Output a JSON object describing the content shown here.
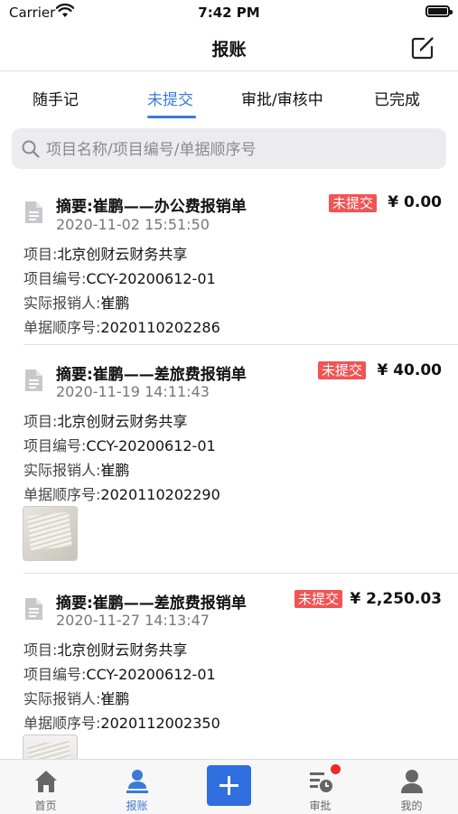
{
  "status": {
    "carrier": "Carrier",
    "time": "7:42 PM"
  },
  "nav": {
    "title": "报账",
    "edit_icon": "edit-icon"
  },
  "tabs": [
    {
      "label": "随手记",
      "active": false
    },
    {
      "label": "未提交",
      "active": true
    },
    {
      "label": "审批/审核中",
      "active": false
    },
    {
      "label": "已完成",
      "active": false
    }
  ],
  "search": {
    "placeholder": "项目名称/项目编号/单据顺序号",
    "value": ""
  },
  "labels": {
    "project": "项目:",
    "project_no": "项目编号:",
    "reimburser": "实际报销人:",
    "serial": "单据顺序号:"
  },
  "colors": {
    "accent": "#3a7bd5",
    "badge": "#f15454"
  },
  "items": [
    {
      "summary": "摘要:崔鹏——办公费报销单",
      "date": "2020-11-02 15:51:50",
      "status": "未提交",
      "amount": "¥ 0.00",
      "project": "北京创财云财务共享",
      "project_no": "CCY-20200612-01",
      "reimburser": "崔鹏",
      "serial": "2020110202286"
    },
    {
      "summary": "摘要:崔鹏——差旅费报销单",
      "date": "2020-11-19 14:11:43",
      "status": "未提交",
      "amount": "¥ 40.00",
      "project": "北京创财云财务共享",
      "project_no": "CCY-20200612-01",
      "reimburser": "崔鹏",
      "serial": "2020110202290"
    },
    {
      "summary": "摘要:崔鹏——差旅费报销单",
      "date": "2020-11-27 14:13:47",
      "status": "未提交",
      "amount": "¥ 2,250.03",
      "project": "北京创财云财务共享",
      "project_no": "CCY-20200612-01",
      "reimburser": "崔鹏",
      "serial": "2020112002350"
    }
  ],
  "tabbar": [
    {
      "label": "首页",
      "icon": "home-icon"
    },
    {
      "label": "报账",
      "icon": "reimburse-icon",
      "active": true
    },
    {
      "label": "",
      "icon": "plus-icon"
    },
    {
      "label": "审批",
      "icon": "approval-icon",
      "has_notification": true
    },
    {
      "label": "我的",
      "icon": "user-icon"
    }
  ]
}
